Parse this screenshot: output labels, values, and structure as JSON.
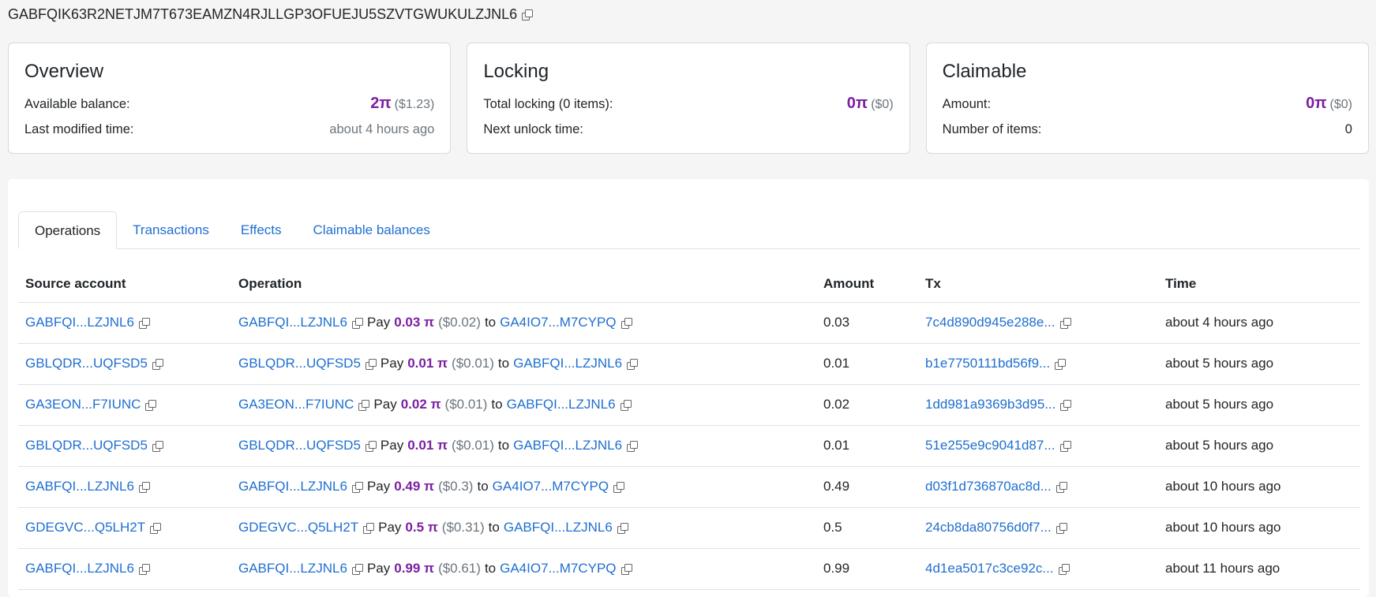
{
  "account": {
    "id": "GABFQIK63R2NETJM7T673EAMZN4RJLLGP3OFUEJU5SZVTGWUKULZJNL6"
  },
  "overview": {
    "title": "Overview",
    "balance_label": "Available balance:",
    "balance_pi": "2π",
    "balance_usd": "($1.23)",
    "modified_label": "Last modified time:",
    "modified_value": "about 4 hours ago"
  },
  "locking": {
    "title": "Locking",
    "total_label": "Total locking (0 items):",
    "total_pi": "0π",
    "total_usd": "($0)",
    "next_label": "Next unlock time:"
  },
  "claimable": {
    "title": "Claimable",
    "amount_label": "Amount:",
    "amount_pi": "0π",
    "amount_usd": "($0)",
    "items_label": "Number of items:",
    "items_value": "0"
  },
  "tabs": [
    {
      "label": "Operations",
      "active": true
    },
    {
      "label": "Transactions",
      "active": false
    },
    {
      "label": "Effects",
      "active": false
    },
    {
      "label": "Claimable balances",
      "active": false
    }
  ],
  "table": {
    "headers": [
      "Source account",
      "Operation",
      "Amount",
      "Tx",
      "Time"
    ],
    "op_word": "Pay",
    "to_word": "to",
    "rows": [
      {
        "source": "GABFQI...LZJNL6",
        "op_from": "GABFQI...LZJNL6",
        "op_amount": "0.03 π",
        "op_usd": "($0.02)",
        "op_to": "GA4IO7...M7CYPQ",
        "amount": "0.03",
        "tx": "7c4d890d945e288e...",
        "time": "about 4 hours ago"
      },
      {
        "source": "GBLQDR...UQFSD5",
        "op_from": "GBLQDR...UQFSD5",
        "op_amount": "0.01 π",
        "op_usd": "($0.01)",
        "op_to": "GABFQI...LZJNL6",
        "amount": "0.01",
        "tx": "b1e7750111bd56f9...",
        "time": "about 5 hours ago"
      },
      {
        "source": "GA3EON...F7IUNC",
        "op_from": "GA3EON...F7IUNC",
        "op_amount": "0.02 π",
        "op_usd": "($0.01)",
        "op_to": "GABFQI...LZJNL6",
        "amount": "0.02",
        "tx": "1dd981a9369b3d95...",
        "time": "about 5 hours ago"
      },
      {
        "source": "GBLQDR...UQFSD5",
        "op_from": "GBLQDR...UQFSD5",
        "op_amount": "0.01 π",
        "op_usd": "($0.01)",
        "op_to": "GABFQI...LZJNL6",
        "amount": "0.01",
        "tx": "51e255e9c9041d87...",
        "time": "about 5 hours ago"
      },
      {
        "source": "GABFQI...LZJNL6",
        "op_from": "GABFQI...LZJNL6",
        "op_amount": "0.49 π",
        "op_usd": "($0.3)",
        "op_to": "GA4IO7...M7CYPQ",
        "amount": "0.49",
        "tx": "d03f1d736870ac8d...",
        "time": "about 10 hours ago"
      },
      {
        "source": "GDEGVC...Q5LH2T",
        "op_from": "GDEGVC...Q5LH2T",
        "op_amount": "0.5 π",
        "op_usd": "($0.31)",
        "op_to": "GABFQI...LZJNL6",
        "amount": "0.5",
        "tx": "24cb8da80756d0f7...",
        "time": "about 10 hours ago"
      },
      {
        "source": "GABFQI...LZJNL6",
        "op_from": "GABFQI...LZJNL6",
        "op_amount": "0.99 π",
        "op_usd": "($0.61)",
        "op_to": "GA4IO7...M7CYPQ",
        "amount": "0.99",
        "tx": "4d1ea5017c3ce92c...",
        "time": "about 11 hours ago"
      }
    ]
  },
  "colors": {
    "link": "#1f6fd0",
    "pi_accent": "#7b1fa2",
    "muted": "#6c757d"
  }
}
